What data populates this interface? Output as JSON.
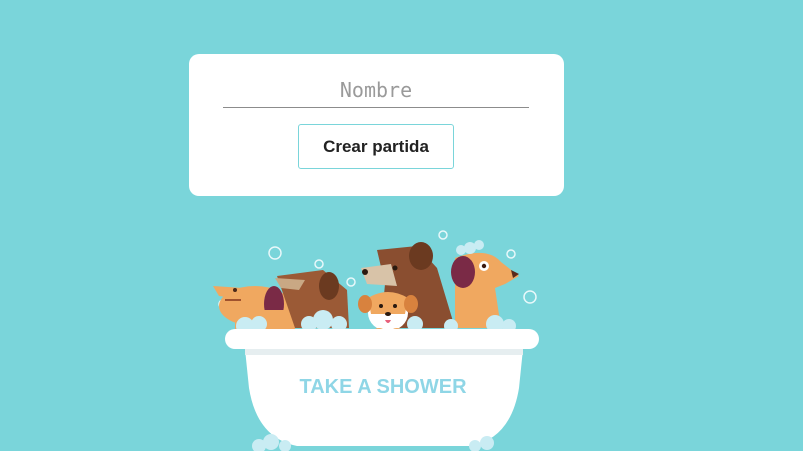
{
  "form": {
    "name_placeholder": "Nombre",
    "name_value": "",
    "create_button_label": "Crear partida"
  },
  "illustration": {
    "caption": "TAKE A SHOWER"
  },
  "colors": {
    "background": "#7ad5da",
    "card": "#ffffff",
    "button_border": "#7ad5da",
    "tub": "#ffffff",
    "tub_text": "#8fd6e6",
    "foam": "#c9ecf3"
  }
}
